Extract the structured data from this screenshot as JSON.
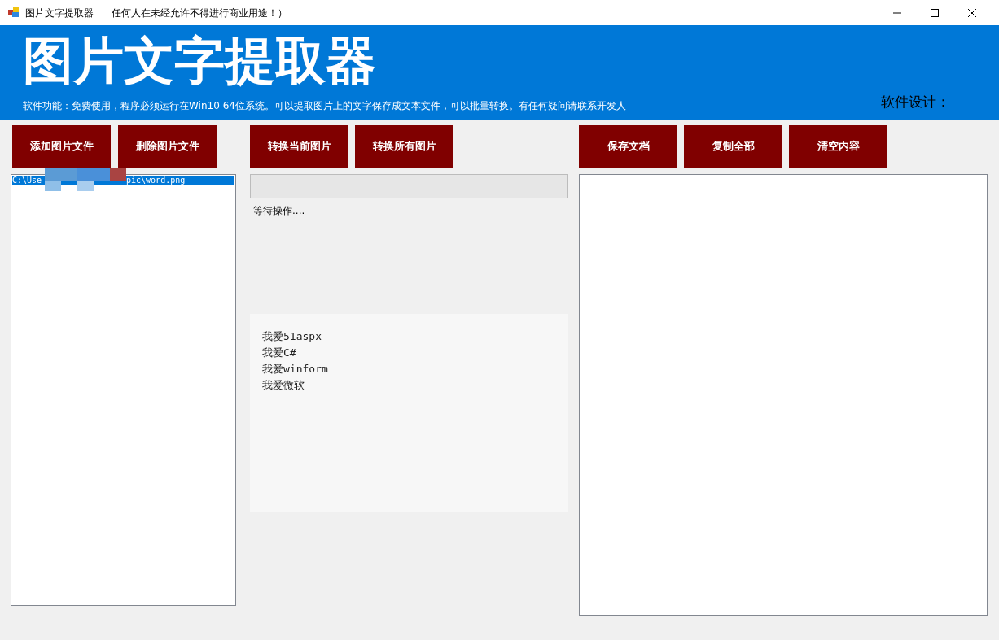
{
  "window": {
    "title": "图片文字提取器",
    "subtitle": "任何人在未经允许不得进行商业用途！）"
  },
  "header": {
    "title": "图片文字提取器",
    "description": "软件功能：免费使用，程序必须运行在Win10 64位系统。可以提取图片上的文字保存成文本文件，可以批量转换。有任何疑问请联系开发人",
    "designer": "软件设计："
  },
  "file_buttons": [
    "添加图片文件",
    "删除图片文件"
  ],
  "file_list": [
    {
      "text_start": "C:\\Use",
      "text_end": "pic\\word.png",
      "selected": true,
      "redacted": true
    }
  ],
  "convert_buttons": [
    "转换当前图片",
    "转换所有图片"
  ],
  "progress": {
    "level": 0
  },
  "status": "等待操作....",
  "preview": {
    "lines": [
      "我爱51aspx",
      "我爱C#",
      "我爱winform",
      "我爱微软"
    ]
  },
  "output_buttons": [
    "保存文档",
    "复制全部",
    "清空内容"
  ]
}
